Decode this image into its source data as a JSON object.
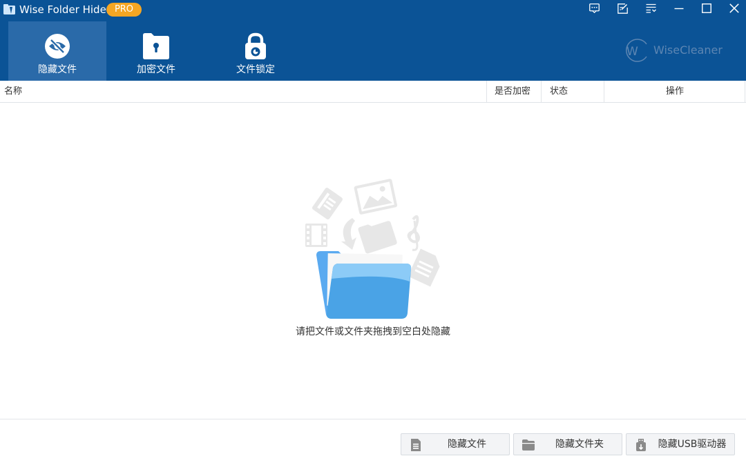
{
  "app": {
    "title": "Wise Folder Hider",
    "badge": "PRO",
    "brand": "WiseCleaner",
    "brand_letter": "W"
  },
  "titlebar_icons": [
    "feedback-icon",
    "edit-icon",
    "menu-icon",
    "minimize-icon",
    "maximize-icon",
    "close-icon"
  ],
  "nav": {
    "tabs": [
      {
        "label": "隐藏文件",
        "icon": "eye-slash-icon",
        "active": true
      },
      {
        "label": "加密文件",
        "icon": "keyhole-document-icon",
        "active": false
      },
      {
        "label": "文件锁定",
        "icon": "padlock-icon",
        "active": false
      }
    ]
  },
  "table": {
    "columns": [
      "名称",
      "是否加密",
      "状态",
      "操作"
    ]
  },
  "empty_state": {
    "message": "请把文件或文件夹拖拽到空白处隐藏"
  },
  "footer": {
    "buttons": [
      {
        "label": "隐藏文件",
        "icon": "file-icon"
      },
      {
        "label": "隐藏文件夹",
        "icon": "folder-icon"
      },
      {
        "label": "隐藏USB驱动器",
        "icon": "usb-drive-icon"
      }
    ]
  },
  "colors": {
    "header_bg": "#0b5396",
    "active_tab_bg": "#2a6aa9",
    "badge": "#f5a623",
    "folder_blue": "#4aa3e6"
  }
}
